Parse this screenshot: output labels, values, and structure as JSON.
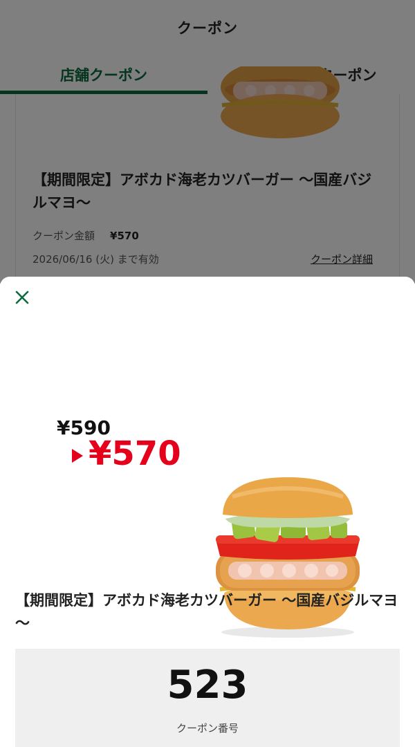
{
  "header": {
    "title": "クーポン"
  },
  "tabs": [
    {
      "label": "店舗クーポン",
      "active": true
    },
    {
      "label": "ネット注文クーポン",
      "active": false
    }
  ],
  "card": {
    "title": "【期間限定】アボカド海老カツバーガー ～国産バジルマヨ～",
    "amount_label": "クーポン金額",
    "amount": "¥570",
    "expiry": "2026/06/16 (火) まで有効",
    "detail_link": "クーポン詳細"
  },
  "modal": {
    "close_icon": "close-icon",
    "old_price": "¥590",
    "new_price": "¥570",
    "title": "【期間限定】アボカド海老カツバーガー ～国産バジルマヨ～",
    "coupon_number": "523",
    "coupon_number_label": "クーポン番号"
  },
  "colors": {
    "accent_green": "#0a6b3d",
    "price_red": "#e5001b",
    "code_box_bg": "#efefef"
  }
}
